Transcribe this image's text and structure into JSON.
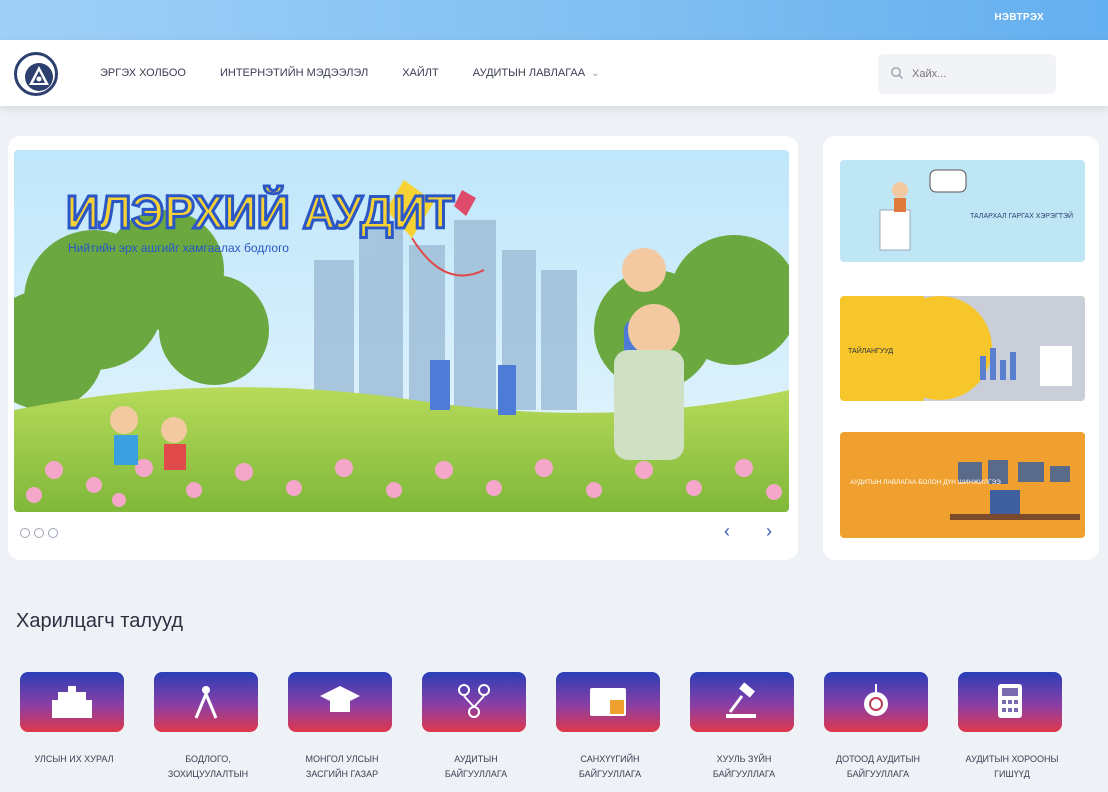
{
  "topstrip": {
    "link": "НЭВТРЭХ"
  },
  "header": {
    "nav": [
      {
        "label": "ЭРГЭХ ХОЛБОО"
      },
      {
        "label": "ИНТЕРНЭТИЙН МЭДЭЭЛЭЛ"
      },
      {
        "label": "ХАЙЛТ"
      },
      {
        "label": "АУДИТЫН ЛАВЛАГАА"
      }
    ],
    "search_placeholder": "Хайх..."
  },
  "banner": {
    "headline": "ИЛЭРХИЙ АУДИТ",
    "subline": "Нийтийн эрх ашгийг хамгаалах бодлого"
  },
  "side_ads": [
    {
      "text": "ТАЛАРХАЛ ГАРГАХ ХЭРЭГТЭЙ"
    },
    {
      "text": "ТАЙЛАНГУУД"
    },
    {
      "text": "АУДИТЫН ЛАВЛАГАА БОЛОН ДҮН ШИНЖИЛГЭЭ"
    }
  ],
  "section": {
    "title": "Харилцагч талууд"
  },
  "partners": [
    {
      "name": "УЛСЫН ИХ ХУРАЛ"
    },
    {
      "name": "БОДЛОГО, ЗОХИЦУУЛАЛТЫН"
    },
    {
      "name": "МОНГОЛ УЛСЫН ЗАСГИЙН ГАЗАР"
    },
    {
      "name": "АУДИТЫН БАЙГУУЛЛАГА"
    },
    {
      "name": "САНХҮҮГИЙН БАЙГУУЛЛАГА"
    },
    {
      "name": "ХУУЛЬ ЗҮЙН БАЙГУУЛЛАГА"
    },
    {
      "name": "ДОТООД АУДИТЫН БАЙГУУЛЛАГА"
    },
    {
      "name": "АУДИТЫН ХОРООНЫ ГИШҮҮД"
    }
  ],
  "colors": {
    "nav_accent": "#2c3f6e",
    "arrow": "#3b5bbf"
  }
}
